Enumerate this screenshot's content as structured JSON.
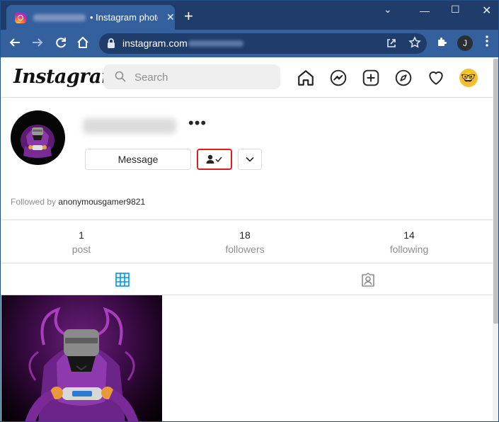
{
  "browser": {
    "tab_title": "• Instagram photos",
    "tab_close": "✕",
    "new_tab": "+",
    "url": "instagram.com",
    "profile_initial": "J",
    "window_controls": {
      "tabs_menu": "⌄",
      "minimize": "—",
      "maximize": "☐",
      "close": "✕"
    }
  },
  "header": {
    "logo": "Instagram",
    "search_placeholder": "Search",
    "avatar_emoji": "🤓"
  },
  "profile": {
    "more_label": "•••",
    "message_button": "Message",
    "following_icon": "👤✓",
    "suggestions_icon": "⌄",
    "followed_by_prefix": "Followed by",
    "followed_by_user": "anonymousgamer9821"
  },
  "stats": [
    {
      "num": "1",
      "label": "post"
    },
    {
      "num": "18",
      "label": "followers"
    },
    {
      "num": "14",
      "label": "following"
    }
  ],
  "colors": {
    "chrome_dark": "#1f3c6a",
    "chrome_toolbar": "#35609e",
    "following_highlight": "#e21c1c",
    "grid_active": "#0095f6"
  }
}
